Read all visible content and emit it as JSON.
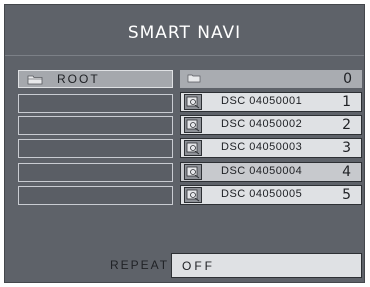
{
  "title": "SMART NAVI",
  "left_panel": {
    "root_label": "ROOT",
    "root_icon": "folder-icon",
    "empty_slots": 5
  },
  "right_panel": {
    "header_number": "0",
    "header_icon": "folder-icon",
    "files": [
      {
        "name": "DSC 04050001",
        "number": "1",
        "icon": "image-file-icon"
      },
      {
        "name": "DSC 04050002",
        "number": "2",
        "icon": "image-file-icon"
      },
      {
        "name": "DSC 04050003",
        "number": "3",
        "icon": "image-file-icon"
      },
      {
        "name": "DSC 04050004",
        "number": "4",
        "icon": "image-file-icon"
      },
      {
        "name": "DSC 04050005",
        "number": "5",
        "icon": "image-file-icon"
      }
    ]
  },
  "repeat": {
    "label": "REPEAT",
    "value": "OFF"
  },
  "colors": {
    "panel_background": "#5e6269",
    "title_text": "#ffffff",
    "row_background": "#dfe1e4",
    "row_highlight": "#c7c9cd",
    "root_background": "#a5a8ad"
  }
}
